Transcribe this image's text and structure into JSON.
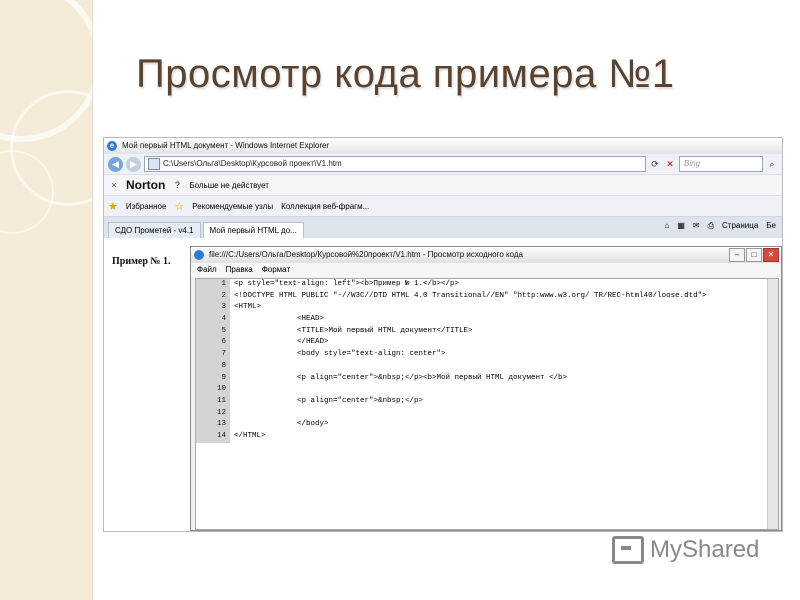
{
  "slide": {
    "title": "Просмотр кода примера №1",
    "watermark": "MyShared"
  },
  "browser": {
    "window_title": "Мой первый HTML документ - Windows Internet Explorer",
    "address": "C:\\Users\\Ольга\\Desktop\\Курсовой проект\\V1.htm",
    "search_placeholder": "Bing",
    "norton": {
      "logo_text": "Norton",
      "status": "Больше не действует"
    },
    "favorites": {
      "label": "Избранное",
      "items": [
        "Рекомендуемые узлы",
        "Коллекция веб-фрагм..."
      ]
    },
    "tabs": [
      "СДО Прометей - v4.1",
      "Мой первый HTML до..."
    ],
    "tools": {
      "page_menu": "Страница",
      "truncated": "Бе"
    }
  },
  "page": {
    "example_label": "Пример № 1."
  },
  "source_window": {
    "title": "file:///C:/Users/Ольга/Desktop/Курсовой%20проект/V1.htm - Просмотр исходного кода",
    "menu": [
      "Файл",
      "Правка",
      "Формат"
    ],
    "lines": [
      {
        "n": "1",
        "t": "<p style=\"text-align: left\"><b>Пример № 1.</b></p>"
      },
      {
        "n": "2",
        "t": "<!DOCTYPE HTML PUBLIC \"-//W3C//DTD HTML 4.0 Transitional//EN\" \"http:www.w3.org/ TR/REC-html40/loose.dtd\">"
      },
      {
        "n": "3",
        "t": "<HTML>"
      },
      {
        "n": "4",
        "t": "              <HEAD>"
      },
      {
        "n": "5",
        "t": "              <TITLE>Мой первый HTML документ</TITLE>"
      },
      {
        "n": "6",
        "t": "              </HEAD>"
      },
      {
        "n": "7",
        "t": "              <body style=\"text-align: center\">"
      },
      {
        "n": "8",
        "t": ""
      },
      {
        "n": "9",
        "t": "              <p align=\"center\">&nbsp;</p><b>Мой первый HTML документ </b>"
      },
      {
        "n": "10",
        "t": ""
      },
      {
        "n": "11",
        "t": "              <p align=\"center\">&nbsp;</p>"
      },
      {
        "n": "12",
        "t": ""
      },
      {
        "n": "13",
        "t": "              </body>"
      },
      {
        "n": "14",
        "t": "</HTML>"
      }
    ]
  }
}
